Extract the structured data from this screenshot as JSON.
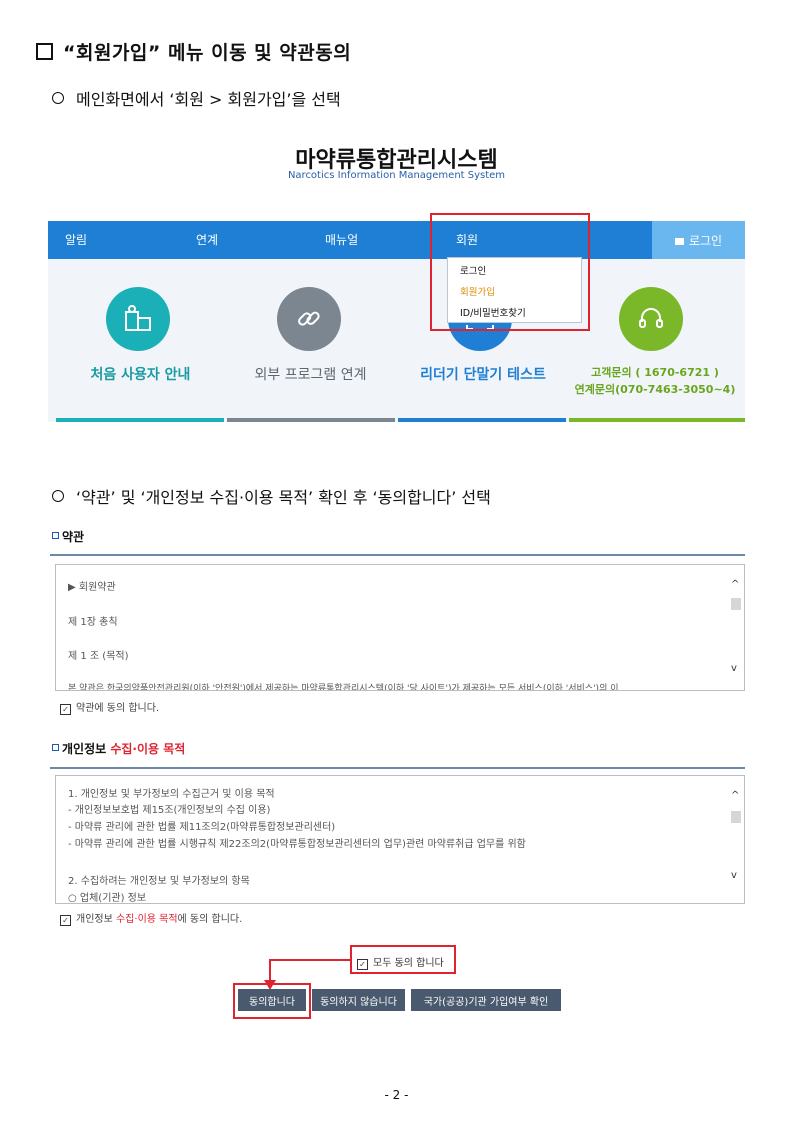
{
  "heading": {
    "title": "“회원가입” 메뉴 이동 및 약관동의"
  },
  "step1": {
    "text": "메인화면에서 ‘회원 > 회원가입’을 선택"
  },
  "site": {
    "title": "마약류통합관리시스템",
    "subtitle": "Narcotics Information Management System",
    "nav": [
      "알림",
      "연계",
      "매뉴얼",
      "회원"
    ],
    "login": "로그인",
    "dropdown": [
      "로그인",
      "회원가입",
      "ID/비밀번호찾기"
    ],
    "features": [
      {
        "label": "처음 사용자 안내",
        "color": "#1bb0b8"
      },
      {
        "label": "외부 프로그램 연계",
        "color": "#7b8690"
      },
      {
        "label": "리더기 단말기 테스트",
        "color": "#1e7fd4"
      },
      {
        "label": "고객문의 ( 1670-6721 )",
        "label2": "연계문의(070-7463-3050~4)",
        "color": "#7ab829"
      }
    ]
  },
  "step2": {
    "text": "‘약관’ 및 ‘개인정보 수집·이용 목적’ 확인 후 ‘동의합니다’ 선택"
  },
  "terms": {
    "title": "약관",
    "lines": [
      "▶ 회원약관",
      "제 1장 총칙",
      "제 1 조 (목적)",
      "본 약관은 한국의약품안전관리원(이하 '안전원')에서 제공하는 마약류통합관리시스템(이하 '당 사이트')가 제공하는 모든 서비스(이하 '서비스')의 이"
    ],
    "agree": "약관에 동의 합니다."
  },
  "privacy": {
    "title_a": "개인정보 ",
    "title_b": "수집·이용 목적",
    "lines": [
      "1. 개인정보 및 부가정보의 수집근거 및 이용 목적",
      " - 개인정보보호법 제15조(개인정보의 수집  이용)",
      " - 마약류 관리에 관한 법률 제11조의2(마약류통합정보관리센터)",
      " - 마약류 관리에 관한 법률 시행규칙 제22조의2(마약류통합정보관리센터의 업무)관련 마약류취급 업무를 위함",
      "",
      "2. 수집하려는 개인정보 및 부가정보의 항목",
      "○ 업체(기관) 정보"
    ],
    "agree_a": "개인정보 ",
    "agree_b": "수집·이용 목적",
    "agree_c": "에 동의 합니다."
  },
  "all_agree": "모두 동의 합니다",
  "buttons": [
    "동의합니다",
    "동의하지 않습니다",
    "국가(공공)기관 가입여부 확인"
  ],
  "page_number": "- 2 -"
}
